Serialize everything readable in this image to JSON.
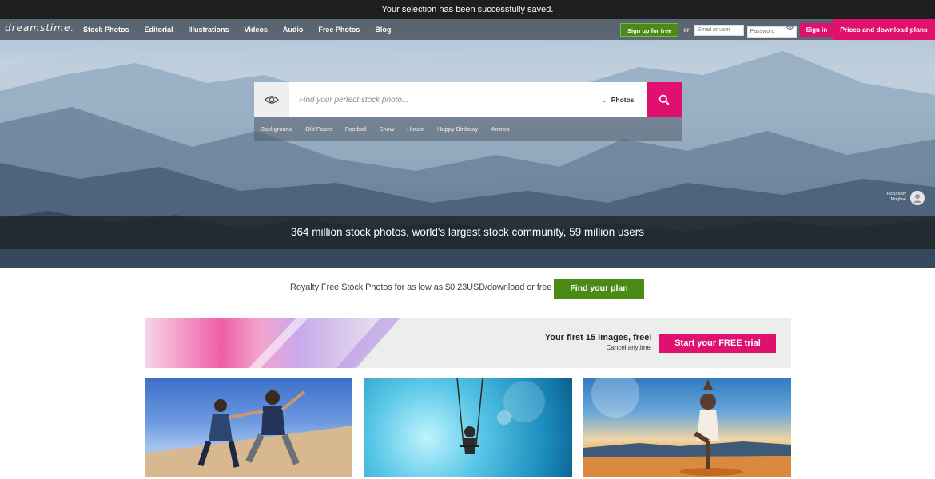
{
  "notification": "Your selection has been successfully saved.",
  "nav": {
    "logo": "dreamstime.",
    "links": [
      "Stock Photos",
      "Editorial",
      "Illustrations",
      "Videos",
      "Audio",
      "Free Photos",
      "Blog"
    ],
    "signup_label": "Sign up for free",
    "or_label": "or",
    "email_placeholder": "Email or user",
    "password_placeholder": "Password",
    "signin_label": "Sign in",
    "prices_label": "Prices and download plans"
  },
  "search": {
    "placeholder": "Find your perfect stock photo...",
    "type_selected": "Photos",
    "tags": [
      "Background",
      "Old Paper",
      "Football",
      "Snow",
      "House",
      "Happy Birthday",
      "Arrows"
    ]
  },
  "credit": {
    "line1": "Picture by",
    "line2": "Mmjhee"
  },
  "stats_text": "364 million stock photos, world's largest stock community, 59 million users",
  "royalty": {
    "text": "Royalty Free Stock Photos for as low as $0.23USD/download or free",
    "button": "Find your plan"
  },
  "promo": {
    "title": "Your first 15 images, free!",
    "subtitle": "Cancel anytime.",
    "button": "Start your FREE trial"
  },
  "colors": {
    "brand_pink": "#e0116e",
    "brand_green": "#4b8a15",
    "notice_bg": "#1e1e1e"
  },
  "icons": {
    "search_eye": "eye-icon",
    "search_button": "magnifier-icon",
    "dropdown": "chevron-down-icon",
    "credit_avatar": "user-avatar-icon"
  }
}
